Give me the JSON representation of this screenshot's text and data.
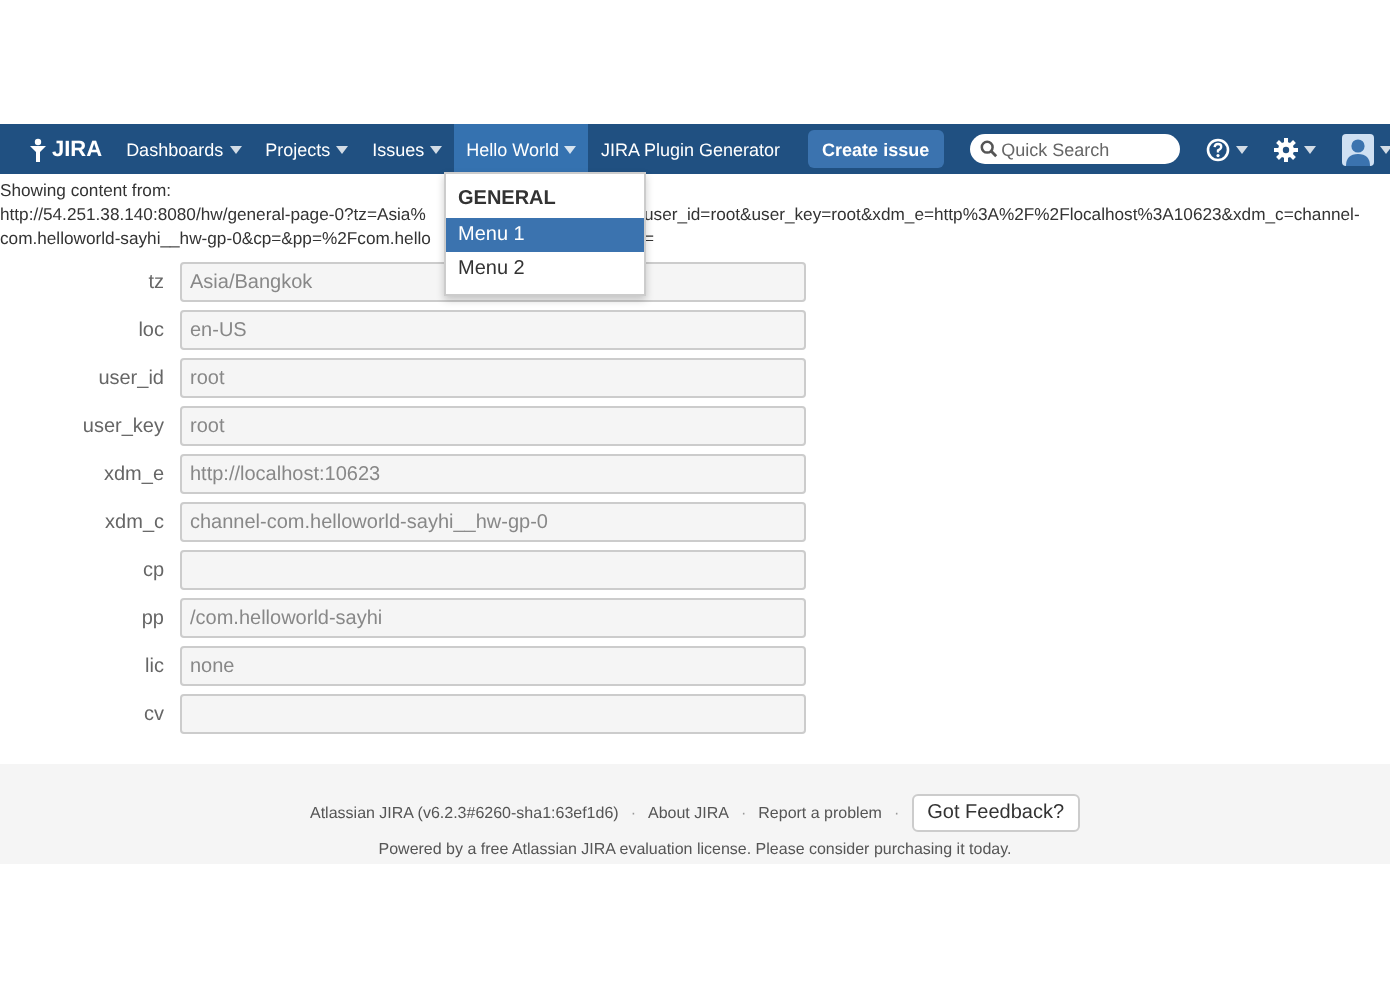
{
  "header": {
    "logo": "JIRA",
    "nav": [
      {
        "label": "Dashboards",
        "caret": true,
        "selected": false
      },
      {
        "label": "Projects",
        "caret": true,
        "selected": false
      },
      {
        "label": "Issues",
        "caret": true,
        "selected": false
      },
      {
        "label": "Hello World",
        "caret": true,
        "selected": true
      },
      {
        "label": "JIRA Plugin Generator",
        "caret": false,
        "selected": false
      }
    ],
    "create_button": "Create issue",
    "search": {
      "placeholder": "Quick Search"
    }
  },
  "dropdown": {
    "heading": "GENERAL",
    "items": [
      {
        "label": "Menu 1",
        "selected": true
      },
      {
        "label": "Menu 2",
        "selected": false
      }
    ]
  },
  "content": {
    "intro": "Showing content from:",
    "url_lines": [
      {
        "left": "http://54.251.38.140:8080/hw/general-page-0?tz=Asia%",
        "right": "user_id=root&user_key=root&xdm_e=http%3A%2F%2Flocalhost%3A10623&xdm_c=channel-"
      },
      {
        "left": "com.helloworld-sayhi__hw-gp-0&cp=&pp=%2Fcom.hello",
        "right": "="
      }
    ],
    "fields": [
      {
        "label": "tz",
        "value": "Asia/Bangkok"
      },
      {
        "label": "loc",
        "value": "en-US"
      },
      {
        "label": "user_id",
        "value": "root"
      },
      {
        "label": "user_key",
        "value": "root"
      },
      {
        "label": "xdm_e",
        "value": "http://localhost:10623"
      },
      {
        "label": "xdm_c",
        "value": "channel-com.helloworld-sayhi__hw-gp-0"
      },
      {
        "label": "cp"
      },
      {
        "label": "pp",
        "value": "/com.helloworld-sayhi"
      },
      {
        "label": "lic",
        "value": "none"
      },
      {
        "label": "cv"
      }
    ]
  },
  "footer": {
    "version": "Atlassian JIRA (v6.2.3#6260-sha1:63ef1d6)",
    "separator": "·",
    "links": [
      "About JIRA",
      "Report a problem"
    ],
    "feedback_button": "Got Feedback?",
    "license_note": "Powered by a free Atlassian JIRA evaluation license. Please consider purchasing it today."
  }
}
